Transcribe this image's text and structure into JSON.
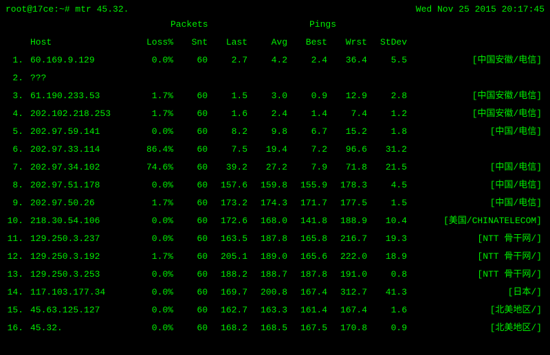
{
  "prompt": "root@17ce:~# mtr 45.32.",
  "timestamp": "Wed Nov 25 2015 20:17:45",
  "section_labels": {
    "packets": "Packets",
    "pings": "Pings"
  },
  "columns": {
    "host": "Host",
    "loss": "Loss%",
    "snt": "Snt",
    "last": "Last",
    "avg": "Avg",
    "best": "Best",
    "wrst": "Wrst",
    "stdev": "StDev"
  },
  "rows": [
    {
      "idx": "1.",
      "host": "60.169.9.129",
      "loss": "0.0%",
      "snt": "60",
      "last": "2.7",
      "avg": "4.2",
      "best": "2.4",
      "wrst": "36.4",
      "stdev": "5.5",
      "loc": "[中国安徽/电信]"
    },
    {
      "idx": "2.",
      "host": "???",
      "loss": "",
      "snt": "",
      "last": "",
      "avg": "",
      "best": "",
      "wrst": "",
      "stdev": "",
      "loc": ""
    },
    {
      "idx": "3.",
      "host": "61.190.233.53",
      "loss": "1.7%",
      "snt": "60",
      "last": "1.5",
      "avg": "3.0",
      "best": "0.9",
      "wrst": "12.9",
      "stdev": "2.8",
      "loc": "[中国安徽/电信]"
    },
    {
      "idx": "4.",
      "host": "202.102.218.253",
      "loss": "1.7%",
      "snt": "60",
      "last": "1.6",
      "avg": "2.4",
      "best": "1.4",
      "wrst": "7.4",
      "stdev": "1.2",
      "loc": "[中国安徽/电信]"
    },
    {
      "idx": "5.",
      "host": "202.97.59.141",
      "loss": "0.0%",
      "snt": "60",
      "last": "8.2",
      "avg": "9.8",
      "best": "6.7",
      "wrst": "15.2",
      "stdev": "1.8",
      "loc": "[中国/电信]"
    },
    {
      "idx": "6.",
      "host": "202.97.33.114",
      "loss": "86.4%",
      "snt": "60",
      "last": "7.5",
      "avg": "19.4",
      "best": "7.2",
      "wrst": "96.6",
      "stdev": "31.2",
      "loc": ""
    },
    {
      "idx": "7.",
      "host": "202.97.34.102",
      "loss": "74.6%",
      "snt": "60",
      "last": "39.2",
      "avg": "27.2",
      "best": "7.9",
      "wrst": "71.8",
      "stdev": "21.5",
      "loc": "[中国/电信]"
    },
    {
      "idx": "8.",
      "host": "202.97.51.178",
      "loss": "0.0%",
      "snt": "60",
      "last": "157.6",
      "avg": "159.8",
      "best": "155.9",
      "wrst": "178.3",
      "stdev": "4.5",
      "loc": "[中国/电信]"
    },
    {
      "idx": "9.",
      "host": "202.97.50.26",
      "loss": "1.7%",
      "snt": "60",
      "last": "173.2",
      "avg": "174.3",
      "best": "171.7",
      "wrst": "177.5",
      "stdev": "1.5",
      "loc": "[中国/电信]"
    },
    {
      "idx": "10.",
      "host": "218.30.54.106",
      "loss": "0.0%",
      "snt": "60",
      "last": "172.6",
      "avg": "168.0",
      "best": "141.8",
      "wrst": "188.9",
      "stdev": "10.4",
      "loc": "[美国/CHINATELECOM]"
    },
    {
      "idx": "11.",
      "host": "129.250.3.237",
      "loss": "0.0%",
      "snt": "60",
      "last": "163.5",
      "avg": "187.8",
      "best": "165.8",
      "wrst": "216.7",
      "stdev": "19.3",
      "loc": "[NTT 骨干网/]"
    },
    {
      "idx": "12.",
      "host": "129.250.3.192",
      "loss": "1.7%",
      "snt": "60",
      "last": "205.1",
      "avg": "189.0",
      "best": "165.6",
      "wrst": "222.0",
      "stdev": "18.9",
      "loc": "[NTT 骨干网/]"
    },
    {
      "idx": "13.",
      "host": "129.250.3.253",
      "loss": "0.0%",
      "snt": "60",
      "last": "188.2",
      "avg": "188.7",
      "best": "187.8",
      "wrst": "191.0",
      "stdev": "0.8",
      "loc": "[NTT 骨干网/]"
    },
    {
      "idx": "14.",
      "host": "117.103.177.34",
      "loss": "0.0%",
      "snt": "60",
      "last": "169.7",
      "avg": "200.8",
      "best": "167.4",
      "wrst": "312.7",
      "stdev": "41.3",
      "loc": "[日本/]"
    },
    {
      "idx": "15.",
      "host": "45.63.125.127",
      "loss": "0.0%",
      "snt": "60",
      "last": "162.7",
      "avg": "163.3",
      "best": "161.4",
      "wrst": "167.4",
      "stdev": "1.6",
      "loc": "[北美地区/]"
    },
    {
      "idx": "16.",
      "host": "45.32.",
      "loss": "0.0%",
      "snt": "60",
      "last": "168.2",
      "avg": "168.5",
      "best": "167.5",
      "wrst": "170.8",
      "stdev": "0.9",
      "loc": "[北美地区/]"
    }
  ]
}
